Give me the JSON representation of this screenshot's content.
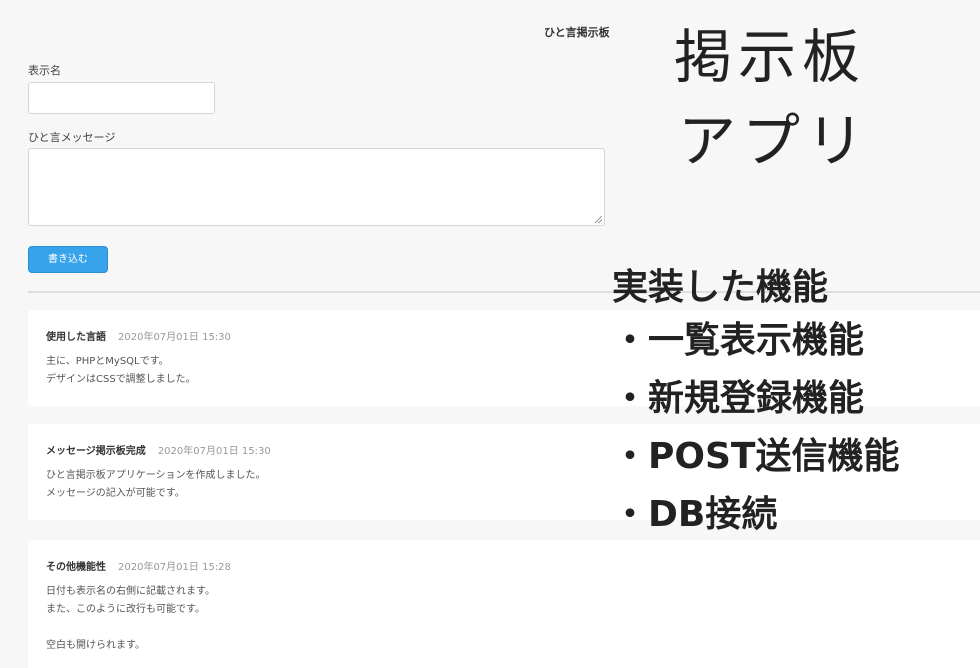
{
  "header": {
    "title": "ひと言掲示板"
  },
  "form": {
    "name_label": "表示名",
    "name_value": "",
    "message_label": "ひと言メッセージ",
    "message_value": "",
    "submit_label": "書き込む"
  },
  "posts": [
    {
      "title": "使用した言語",
      "date": "2020年07月01日 15:30",
      "lines": [
        "主に、PHPとMySQLです。",
        "デザインはCSSで調整しました。"
      ]
    },
    {
      "title": "メッセージ掲示板完成",
      "date": "2020年07月01日 15:30",
      "lines": [
        "ひと言掲示板アプリケーションを作成しました。",
        "メッセージの記入が可能です。"
      ]
    },
    {
      "title": "その他機能性",
      "date": "2020年07月01日 15:28",
      "lines": [
        "日付も表示名の右側に記載されます。",
        "また、このように改行も可能です。",
        "",
        "空白も開けられます。"
      ]
    }
  ],
  "overlay": {
    "heading_line1": "掲示板",
    "heading_line2": "アプリ",
    "features_title": "実装した機能",
    "features": [
      "・一覧表示機能",
      "・新規登録機能",
      "・POST送信機能",
      "・DB接続"
    ]
  },
  "colors": {
    "accent": "#37a3eb",
    "background": "#f7f7f7",
    "card": "#ffffff"
  }
}
